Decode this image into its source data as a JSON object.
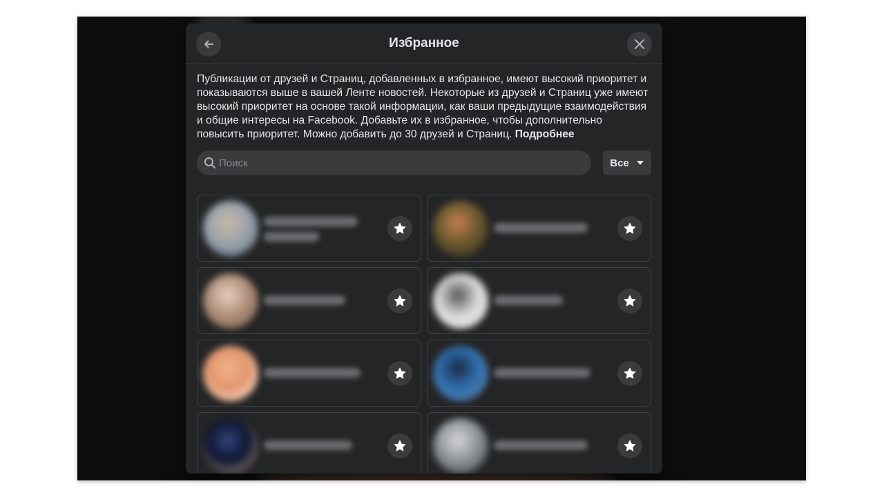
{
  "dialog": {
    "title": "Избранное",
    "description": "Публикации от друзей и Страниц, добавленных в избранное, имеют высокий приоритет и показываются выше в вашей Ленте новостей. Некоторые из друзей и Страниц уже имеют высокий приоритет на основе такой информации, как ваши предыдущие взаимодействия и общие интересы на Facebook. Добавьте их в избранное, чтобы дополнительно повысить приоритет. Можно добавить до 30 друзей и Страниц.",
    "learn_more": "Подробнее",
    "back_icon": "arrow-left-icon",
    "close_icon": "close-icon"
  },
  "search": {
    "placeholder": "Поиск",
    "value": "",
    "icon": "search-icon"
  },
  "filter": {
    "label": "Все",
    "icon": "caret-down-icon"
  },
  "friends": [
    {
      "name_hidden": true,
      "favorite": true,
      "avatar_colors": [
        "#9aa3ad",
        "#c9b8a3",
        "#5b6a7a"
      ]
    },
    {
      "name_hidden": true,
      "favorite": true,
      "avatar_colors": [
        "#6b5a2e",
        "#c77e52",
        "#2a2a22"
      ]
    },
    {
      "name_hidden": true,
      "favorite": true,
      "avatar_colors": [
        "#b08f7a",
        "#e8d2c0",
        "#6f5a4c"
      ]
    },
    {
      "name_hidden": true,
      "favorite": true,
      "avatar_colors": [
        "#d8d8d8",
        "#555555",
        "#f0f0f0"
      ]
    },
    {
      "name_hidden": true,
      "favorite": true,
      "avatar_colors": [
        "#e0946a",
        "#f2b48e",
        "#ffffff"
      ]
    },
    {
      "name_hidden": true,
      "favorite": true,
      "avatar_colors": [
        "#2f6fb0",
        "#1b2a44",
        "#6c7f99"
      ]
    },
    {
      "name_hidden": true,
      "favorite": true,
      "avatar_colors": [
        "#0e1630",
        "#31467e",
        "#c7a08c"
      ]
    },
    {
      "name_hidden": true,
      "favorite": true,
      "avatar_colors": [
        "#8e9499",
        "#d6d8da",
        "#3c4043"
      ]
    }
  ],
  "colors": {
    "modal_bg": "#242526",
    "control_bg": "#3a3b3c",
    "text": "#e4e6eb",
    "border": "#3e4042",
    "backdrop": "#0d0d0e"
  }
}
